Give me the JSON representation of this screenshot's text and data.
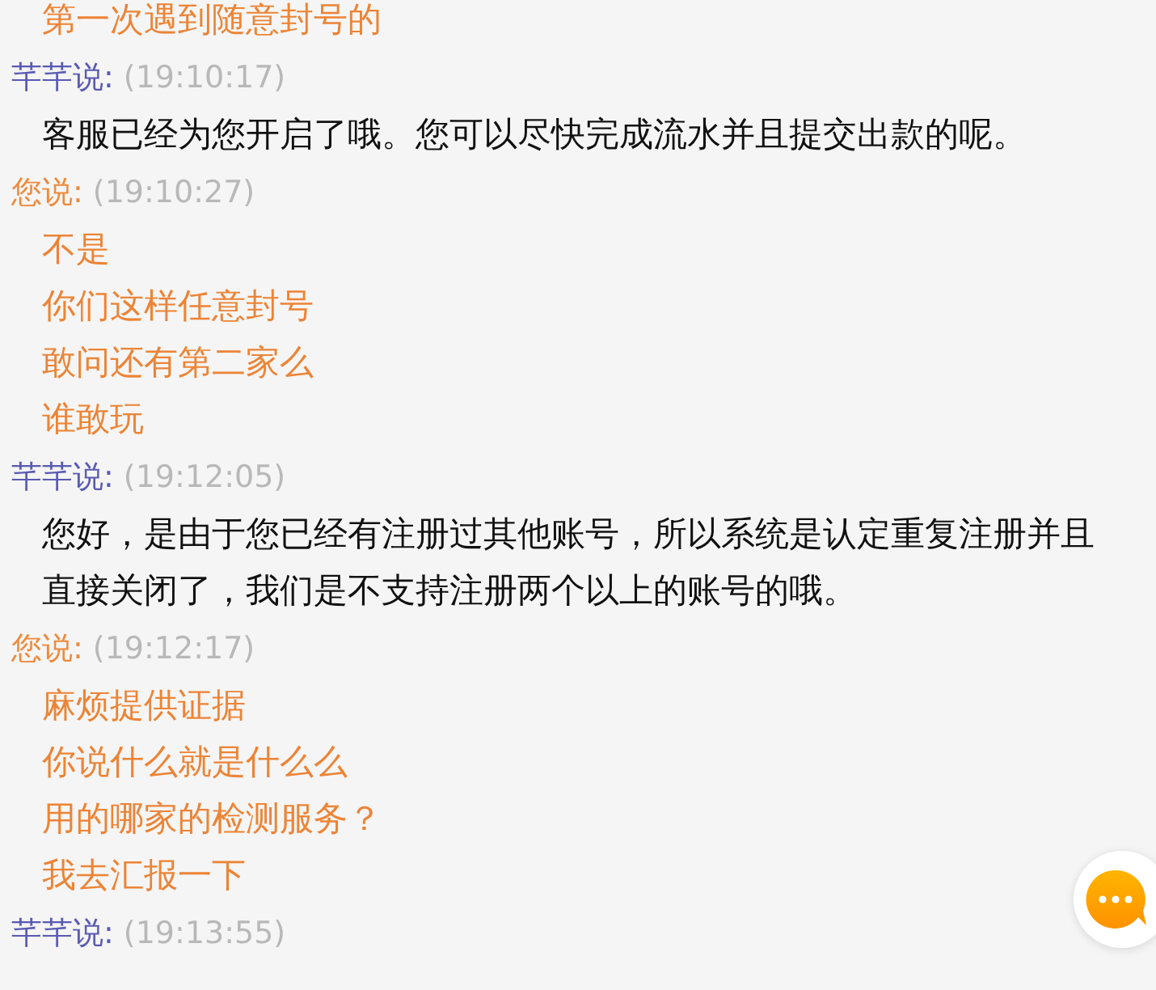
{
  "messages": [
    {
      "kind": "user",
      "lines": [
        "第一次遇到随意封号的"
      ]
    },
    {
      "kind": "agent",
      "sender": "芊芊说:",
      "time": "(19:10:17)",
      "lines": [
        "客服已经为您开启了哦。您可以尽快完成流水并且提交出款的呢。"
      ]
    },
    {
      "kind": "user",
      "sender": "您说:",
      "time": "(19:10:27)",
      "lines": [
        "不是",
        "你们这样任意封号",
        "敢问还有第二家么",
        "谁敢玩"
      ]
    },
    {
      "kind": "agent",
      "sender": "芊芊说:",
      "time": "(19:12:05)",
      "lines": [
        "您好，是由于您已经有注册过其他账号，所以系统是认定重复注册并且直接关闭了，我们是不支持注册两个以上的账号的哦。"
      ]
    },
    {
      "kind": "user",
      "sender": "您说:",
      "time": "(19:12:17)",
      "lines": [
        "麻烦提供证据",
        "你说什么就是什么么",
        "用的哪家的检测服务？",
        "我去汇报一下"
      ]
    },
    {
      "kind": "agent",
      "sender": "芊芊说:",
      "time": "(19:13:55)"
    }
  ]
}
